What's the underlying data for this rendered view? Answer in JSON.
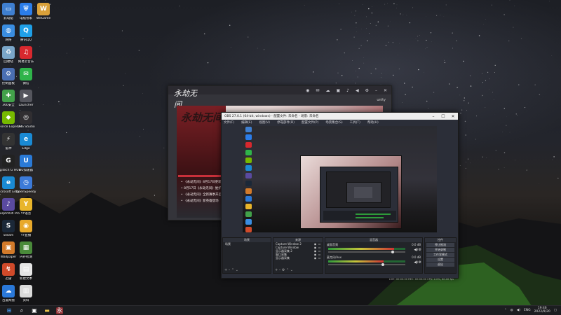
{
  "desktop": {
    "icons": [
      {
        "label": "此电脑",
        "icon": "computer-icon",
        "color": "#3f7fd0",
        "glyph": "▭",
        "col": 0,
        "row": 0
      },
      {
        "label": "电脑管家",
        "icon": "shield-icon",
        "color": "#2b7de9",
        "glyph": "⛨",
        "col": 1,
        "row": 0
      },
      {
        "label": "WeGame",
        "icon": "wegame-icon",
        "color": "#d9a13a",
        "glyph": "W",
        "col": 2,
        "row": 0
      },
      {
        "label": "网络",
        "icon": "network-icon",
        "color": "#3a8de0",
        "glyph": "◍",
        "col": 0,
        "row": 1
      },
      {
        "label": "腾讯QQ",
        "icon": "qq-icon",
        "color": "#1fa0e8",
        "glyph": "Q",
        "col": 1,
        "row": 1
      },
      {
        "label": "回收站",
        "icon": "recycle-bin-icon",
        "color": "#7aa6c9",
        "glyph": "♻",
        "col": 0,
        "row": 2
      },
      {
        "label": "网易云音乐",
        "icon": "music-icon",
        "color": "#d8282e",
        "glyph": "♫",
        "col": 1,
        "row": 2
      },
      {
        "label": "控制面板",
        "icon": "control-panel-icon",
        "color": "#4a6fb3",
        "glyph": "⚙",
        "col": 0,
        "row": 3
      },
      {
        "label": "微信",
        "icon": "wechat-icon",
        "color": "#2fb44a",
        "glyph": "✉",
        "col": 1,
        "row": 3
      },
      {
        "label": "360安全",
        "icon": "antivirus-icon",
        "color": "#42a14a",
        "glyph": "✚",
        "col": 0,
        "row": 4
      },
      {
        "label": "Launcher",
        "icon": "launcher-icon",
        "color": "#55565e",
        "glyph": "▶",
        "col": 1,
        "row": 4
      },
      {
        "label": "GeForce Experience",
        "icon": "nvidia-icon",
        "color": "#76b900",
        "glyph": "◆",
        "col": 0,
        "row": 5
      },
      {
        "label": "OBS Studio",
        "icon": "obs-icon",
        "color": "#302e31",
        "glyph": "◎",
        "col": 1,
        "row": 5
      },
      {
        "label": "雷神",
        "icon": "speed-icon",
        "color": "#333333",
        "glyph": "⚡",
        "col": 0,
        "row": 6
      },
      {
        "label": "Edge",
        "icon": "edge-icon",
        "color": "#1a8ad4",
        "glyph": "e",
        "col": 1,
        "row": 6
      },
      {
        "label": "Logitech G HUB",
        "icon": "logitech-icon",
        "color": "#222222",
        "glyph": "G",
        "col": 0,
        "row": 7
      },
      {
        "label": "UU加速器",
        "icon": "accelerator-icon",
        "color": "#2a7ad6",
        "glyph": "U",
        "col": 1,
        "row": 7
      },
      {
        "label": "Microsoft Edge",
        "icon": "browser-icon",
        "color": "#1a8ad4",
        "glyph": "e",
        "col": 0,
        "row": 8
      },
      {
        "label": "OpenSpeedy",
        "icon": "clock-icon",
        "color": "#3c7ad8",
        "glyph": "◷",
        "col": 1,
        "row": 8
      },
      {
        "label": "MorphVOX Pro",
        "icon": "voice-icon",
        "color": "#5a4aa0",
        "glyph": "♪",
        "col": 0,
        "row": 9
      },
      {
        "label": "YY语音",
        "icon": "yy-icon",
        "color": "#e8b52b",
        "glyph": "Y",
        "col": 1,
        "row": 9
      },
      {
        "label": "Steam",
        "icon": "steam-icon",
        "color": "#1b2838",
        "glyph": "S",
        "col": 0,
        "row": 10
      },
      {
        "label": "YY直播",
        "icon": "owl-icon",
        "color": "#e8a92b",
        "glyph": "◉",
        "col": 1,
        "row": 10
      },
      {
        "label": "Wallpaper",
        "icon": "wallpaper-icon",
        "color": "#d27a2a",
        "glyph": "▣",
        "col": 0,
        "row": 11
      },
      {
        "label": "内存检测",
        "icon": "memory-icon",
        "color": "#4a8a3a",
        "glyph": "▦",
        "col": 1,
        "row": 11
      },
      {
        "label": "迅雷",
        "icon": "thunder-icon",
        "color": "#d04a2a",
        "glyph": "↯",
        "col": 0,
        "row": 12
      },
      {
        "label": "新建文本",
        "icon": "document-icon",
        "color": "#e6e6e6",
        "glyph": "▤",
        "col": 1,
        "row": 12
      },
      {
        "label": "百度网盘",
        "icon": "cloud-icon",
        "color": "#2a78d8",
        "glyph": "☁",
        "col": 0,
        "row": 13
      },
      {
        "label": "资料",
        "icon": "file-icon",
        "color": "#dadada",
        "glyph": "▥",
        "col": 1,
        "row": 13
      }
    ]
  },
  "launcher": {
    "game_title": "永劫无间",
    "unity_label": "unity",
    "notices": [
      "《永劫无间》8月17日更新公告",
      "8月17日《永劫无间》维护",
      "《永劫无间》全新赛季开启",
      "《永劫无间》新英雄登场"
    ]
  },
  "obs": {
    "title": "OBS 27.0.1 (64-bit, windows) - 配置文件: 未命名 - 场景: 未命名",
    "menu": [
      "文件(F)",
      "编辑(E)",
      "视图(V)",
      "停靠部件(D)",
      "配置文件(P)",
      "场景集合(S)",
      "工具(T)",
      "帮助(H)"
    ],
    "docks": {
      "scenes": {
        "header": "场景",
        "items": [
          "场景"
        ]
      },
      "sources": {
        "header": "来源",
        "items": [
          "Capture Window 2",
          "Capture Window",
          "显示器采集 2",
          "窗口采集",
          "显示器采集"
        ]
      },
      "mixer": {
        "header": "混音器",
        "channels": [
          {
            "name": "桌面音频",
            "db": "0.0 dB",
            "level": 0.85
          },
          {
            "name": "麦克风/Aux",
            "db": "0.0 dB",
            "level": 0.72
          }
        ]
      },
      "transitions": {
        "header": "场景过渡",
        "fade": "淡出"
      },
      "controls": {
        "header": "控件",
        "buttons": [
          "停止推流",
          "开始录制",
          "工作室模式",
          "设置",
          "退出"
        ]
      }
    },
    "status": "LIVE: 00:00:00   REC: 00:00:00   CPU: 2.0%, 60.00 fps"
  },
  "taskbar": {
    "time": "19:46",
    "date": "2022/9/20",
    "ime": "ENG"
  }
}
